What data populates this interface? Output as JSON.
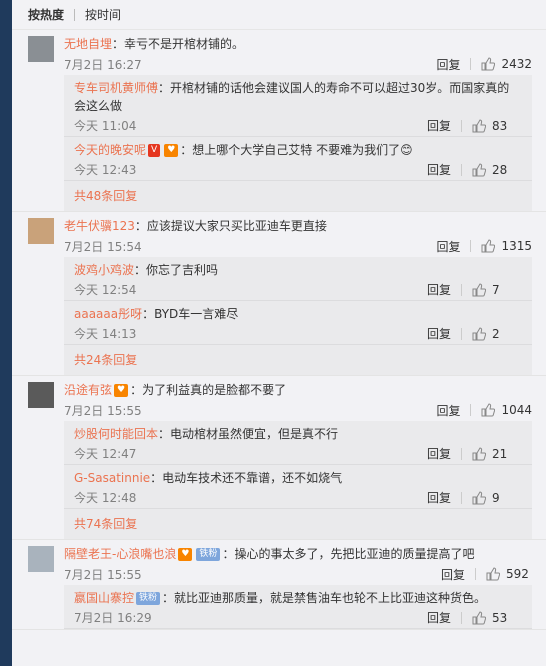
{
  "sort": {
    "hot": "按热度",
    "time": "按时间"
  },
  "reply_label": "回复",
  "like_icon": "thumbs-up-icon",
  "colors": {
    "username": "#eb7350",
    "left_strip": "#1f3a5c"
  },
  "comments": [
    {
      "user": "无地自埋",
      "text": "：幸亏不是开棺材铺的。",
      "time": "7月2日 16:27",
      "likes": "2432",
      "replies": [
        {
          "user": "专车司机黄师傅",
          "text": "：开棺材铺的话他会建议国人的寿命不可以超过30岁。而国家真的会这么做",
          "time": "今天 11:04",
          "likes": "83"
        },
        {
          "user": "今天的晚安呢",
          "badges": [
            "V",
            "♥"
          ],
          "text": "：想上哪个大学自己艾特 不要难为我们了😊",
          "time": "今天 12:43",
          "likes": "28"
        }
      ],
      "more": "共48条回复"
    },
    {
      "user": "老牛伏骥123",
      "text": "：应该提议大家只买比亚迪车更直接",
      "time": "7月2日 15:54",
      "likes": "1315",
      "replies": [
        {
          "user": "波鸡小鸡波",
          "text": "：你忘了吉利吗",
          "time": "今天 12:54",
          "likes": "7"
        },
        {
          "user": "aaaaaa彤呀",
          "text": "：BYD车一言难尽",
          "time": "今天 14:13",
          "likes": "2"
        }
      ],
      "more": "共24条回复"
    },
    {
      "user": "沿途有弦",
      "badges": [
        "♥"
      ],
      "text": "：为了利益真的是脸都不要了",
      "time": "7月2日 15:55",
      "likes": "1044",
      "replies": [
        {
          "user": "炒股何时能回本",
          "text": "：电动棺材虽然便宜，但是真不行",
          "time": "今天 12:47",
          "likes": "21"
        },
        {
          "user": "G-Sasatinnie",
          "text": "：电动车技术还不靠谱，还不如烧气",
          "time": "今天 12:48",
          "likes": "9"
        }
      ],
      "more": "共74条回复"
    },
    {
      "user": "隔壁老王-心浪嘴也浪",
      "badges": [
        "♥",
        "铁粉"
      ],
      "text": "：操心的事太多了，先把比亚迪的质量提高了吧",
      "time": "7月2日 15:55",
      "likes": "592",
      "replies": [
        {
          "user": "嬴国山寨控",
          "badges": [
            "铁粉"
          ],
          "text": "：就比亚迪那质量，就是禁售油车也轮不上比亚迪这种货色。",
          "time": "7月2日 16:29",
          "likes": "53"
        }
      ],
      "more": ""
    }
  ]
}
